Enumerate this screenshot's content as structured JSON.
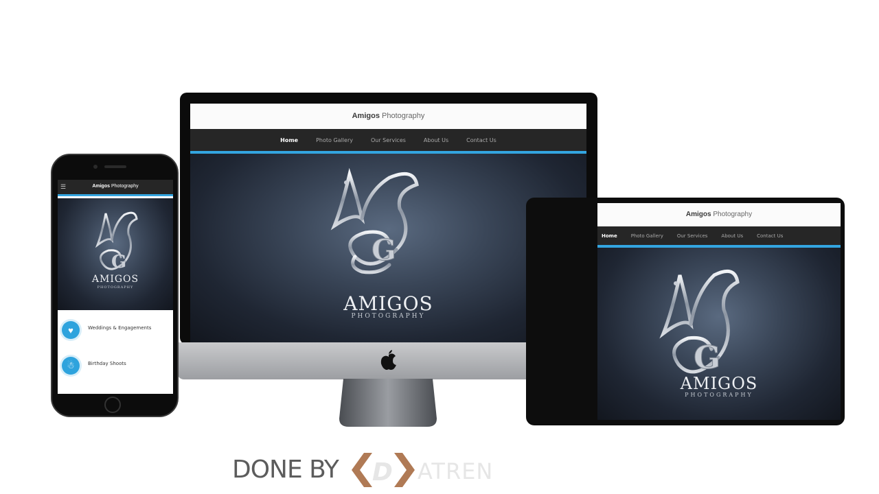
{
  "site": {
    "brand_bold": "Amigos",
    "brand_light": "Photography",
    "logo_word": "AMIGOS",
    "logo_sub": "PHOTOGRAPHY"
  },
  "nav": {
    "items": [
      "Home",
      "Photo Gallery",
      "Our Services",
      "About Us",
      "Contact Us"
    ],
    "active": "Home"
  },
  "phone": {
    "menu_icon": "hamburger-icon",
    "logo_sub": "PHOTOGRAPHY",
    "services": [
      {
        "label": "Weddings & Engagements",
        "icon": "heart-icon"
      },
      {
        "label": "Birthday Shoots",
        "icon": "baby-icon"
      }
    ]
  },
  "footer": {
    "done_by": "DONE BY",
    "author": "ATREN",
    "logo_letter": "D"
  },
  "colors": {
    "accent": "#33a5e0",
    "nav_bg": "#262626",
    "header_bg": "#fbfbfb"
  }
}
